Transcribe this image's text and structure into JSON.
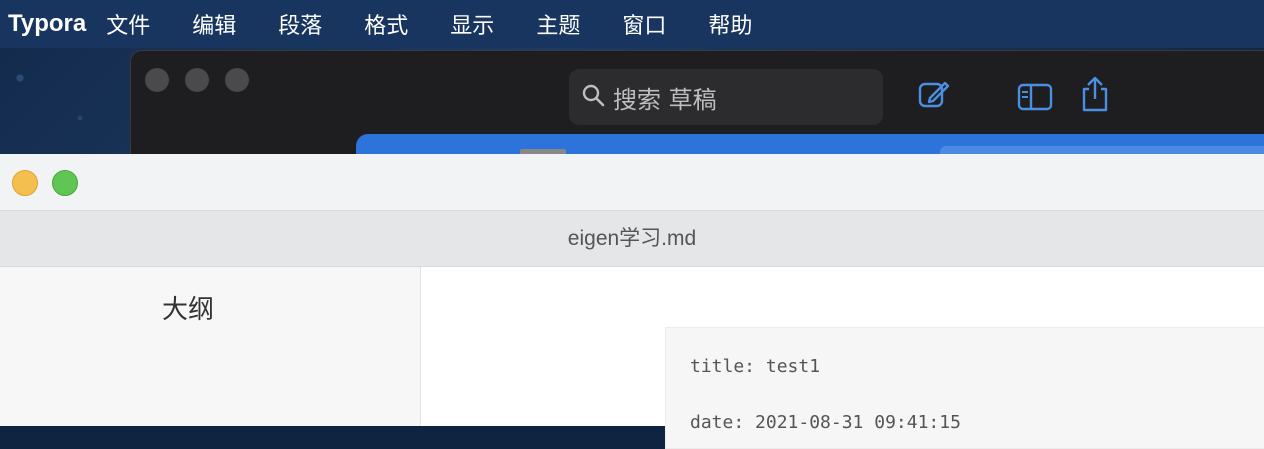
{
  "menubar": {
    "app_name": "Typora",
    "items": [
      "文件",
      "编辑",
      "段落",
      "格式",
      "显示",
      "主题",
      "窗口",
      "帮助"
    ]
  },
  "background_window": {
    "search_placeholder": "搜索 草稿",
    "icons": [
      "search-icon",
      "compose-icon",
      "sidebar-toggle-icon",
      "share-icon"
    ]
  },
  "window": {
    "filename": "eigen学习.md",
    "colors": {
      "minimize": "#f5bf4f",
      "zoom": "#61c554"
    }
  },
  "sidebar": {
    "heading": "大纲"
  },
  "document": {
    "front_matter": [
      "title: test1",
      "date: 2021-08-31 09:41:15"
    ]
  }
}
